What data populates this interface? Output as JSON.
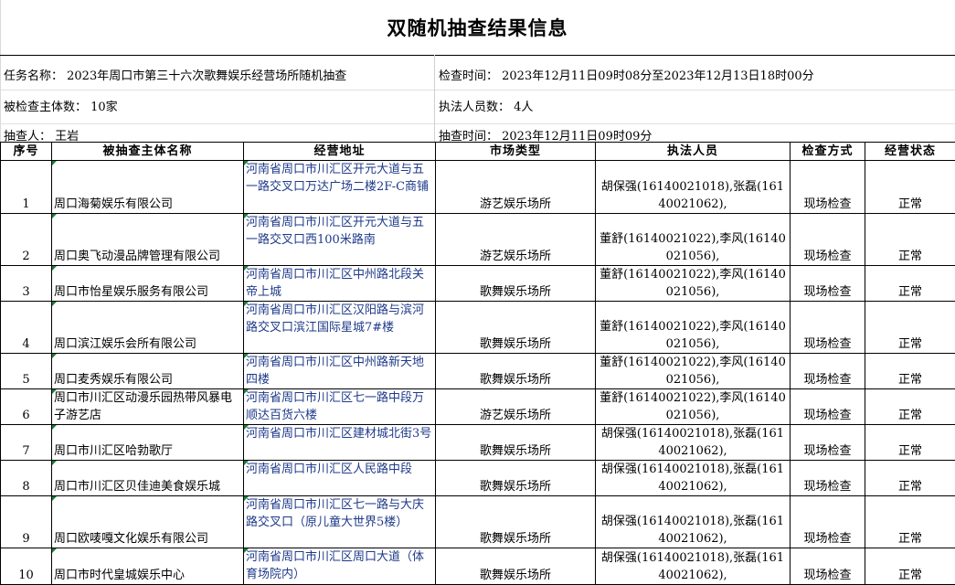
{
  "title": "双随机抽查结果信息",
  "info": {
    "task_name": "任务名称：  2023年周口市第三十六次歌舞娱乐经营场所随机抽查",
    "check_time": "检查时间：   2023年12月11日09时08分至2023年12月13日18时00分",
    "subject_count": "被检查主体数：  10家",
    "enforcer_count": "执法人员数：   4人",
    "sampler": "抽查人：   王岩",
    "sample_time": "抽查时间：   2023年12月11日09时09分"
  },
  "table": {
    "headers": [
      "序号",
      "被抽查主体名称",
      "经营地址",
      "市场类型",
      "执法人员",
      "检查方式",
      "经营状态"
    ],
    "rows": [
      {
        "no": "1",
        "name": "周口海菊娱乐有限公司",
        "address": "河南省周口市川汇区开元大道与五一路交叉口万达广场二楼2F-C商铺",
        "type": "游艺娱乐场所",
        "staff": "胡保强(16140021018),张磊(16140021062),",
        "method": "现场检查",
        "status": "正常"
      },
      {
        "no": "2",
        "name": "周口奥飞动漫品牌管理有限公司",
        "address": "河南省周口市川汇区开元大道与五一路交叉口西100米路南",
        "type": "游艺娱乐场所",
        "staff": "董舒(16140021022),李风(16140021056),",
        "method": "现场检查",
        "status": "正常"
      },
      {
        "no": "3",
        "name": "周口市怡星娱乐服务有限公司",
        "address": "河南省周口市川汇区中州路北段关帝上城",
        "type": "歌舞娱乐场所",
        "staff": "董舒(16140021022),李风(16140021056),",
        "method": "现场检查",
        "status": "正常"
      },
      {
        "no": "4",
        "name": "周口滨江娱乐会所有限公司",
        "address": "河南省周口市川汇区汉阳路与滨河路交叉口滨江国际星城7#楼",
        "type": "歌舞娱乐场所",
        "staff": "董舒(16140021022),李风(16140021056),",
        "method": "现场检查",
        "status": "正常"
      },
      {
        "no": "5",
        "name": "周口麦秀娱乐有限公司",
        "address": "河南省周口市川汇区中州路新天地四楼",
        "type": "歌舞娱乐场所",
        "staff": "董舒(16140021022),李风(16140021056),",
        "method": "现场检查",
        "status": "正常"
      },
      {
        "no": "6",
        "name": "周口市川汇区动漫乐园热带风暴电子游艺店",
        "address": "河南省周口市川汇区七一路中段万顺达百货六楼",
        "type": "游艺娱乐场所",
        "staff": "董舒(16140021022),李风(16140021056),",
        "method": "现场检查",
        "status": "正常"
      },
      {
        "no": "7",
        "name": "周口市川汇区哈勃歌厅",
        "address": "河南省周口市川汇区建材城北街3号",
        "type": "歌舞娱乐场所",
        "staff": "胡保强(16140021018),张磊(16140021062),",
        "method": "现场检查",
        "status": "正常"
      },
      {
        "no": "8",
        "name": "周口市川汇区贝佳迪美食娱乐城",
        "address": "河南省周口市川汇区人民路中段",
        "type": "歌舞娱乐场所",
        "staff": "胡保强(16140021018),张磊(16140021062),",
        "method": "现场检查",
        "status": "正常"
      },
      {
        "no": "9",
        "name": "周口欧唛嘎文化娱乐有限公司",
        "address": "河南省周口市川汇区七一路与大庆路交叉口（原儿童大世界5楼）",
        "type": "歌舞娱乐场所",
        "staff": "胡保强(16140021018),张磊(16140021062),",
        "method": "现场检查",
        "status": "正常"
      },
      {
        "no": "10",
        "name": "周口市时代皇城娱乐中心",
        "address": "河南省周口市川汇区周口大道（体育场院内）",
        "type": "歌舞娱乐场所",
        "staff": "胡保强(16140021018),张磊(16140021062),",
        "method": "现场检查",
        "status": "正常"
      }
    ]
  }
}
